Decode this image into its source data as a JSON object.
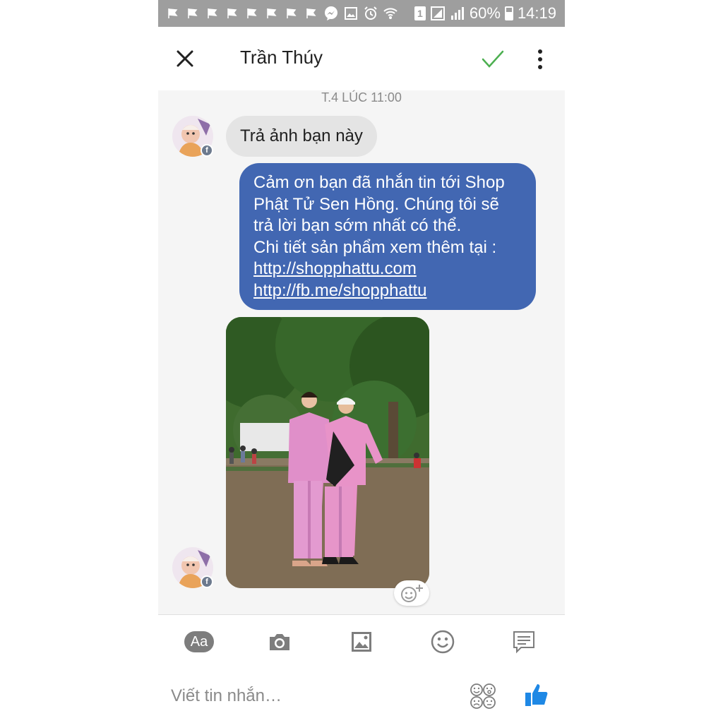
{
  "status_bar": {
    "battery": "60%",
    "time": "14:19",
    "sim": "1",
    "notification_icons": [
      "flag-icon",
      "flag-icon",
      "flag-icon",
      "flag-icon",
      "flag-icon",
      "flag-icon",
      "flag-icon",
      "flag-icon",
      "messenger-icon",
      "image-icon",
      "alarm-icon",
      "wifi-icon"
    ]
  },
  "header": {
    "contact_name": "Trần Thúy"
  },
  "thread": {
    "timestamp": "T.4 LÚC 11:00",
    "incoming_message": "Trả ảnh bạn này",
    "outgoing_message": {
      "lines": [
        "Cảm ơn bạn  đã nhắn tin tới Shop",
        "Phật Tử Sen Hồng. Chúng tôi sẽ",
        "trả lời bạn sớm nhất có thể.",
        "Chi tiết sản phẩm xem thêm tại :"
      ],
      "links": [
        "http://shopphattu.com",
        "http://fb.me/shopphattu"
      ]
    }
  },
  "composer": {
    "aa_label": "Aa",
    "placeholder": "Viết tin nhắn…"
  },
  "colors": {
    "accent_blue": "#4267b2",
    "like_blue": "#1e88e5",
    "check_green": "#4caf50",
    "incoming_bubble": "#e4e4e4",
    "thread_bg": "#f5f5f5",
    "status_bar": "#9e9e9e"
  }
}
